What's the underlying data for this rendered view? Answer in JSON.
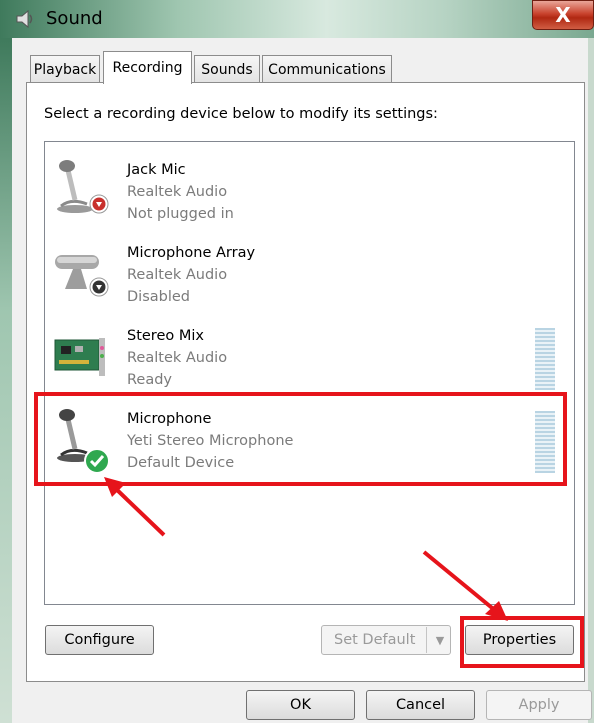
{
  "window": {
    "title": "Sound",
    "close_label": "X"
  },
  "tabs": [
    {
      "label": "Playback",
      "active": false
    },
    {
      "label": "Recording",
      "active": true
    },
    {
      "label": "Sounds",
      "active": false
    },
    {
      "label": "Communications",
      "active": false
    }
  ],
  "instruction": "Select a recording device below to modify its settings:",
  "devices": [
    {
      "name": "Jack Mic",
      "driver": "Realtek Audio",
      "status": "Not plugged in",
      "icon": "microphone-icon",
      "badge": "red-down-arrow"
    },
    {
      "name": "Microphone Array",
      "driver": "Realtek Audio",
      "status": "Disabled",
      "icon": "microphone-array-icon",
      "badge": "black-down-arrow"
    },
    {
      "name": "Stereo Mix",
      "driver": "Realtek Audio",
      "status": "Ready",
      "icon": "sound-card-icon",
      "badge": "",
      "level": 0
    },
    {
      "name": "Microphone",
      "driver": "Yeti Stereo Microphone",
      "status": "Default Device",
      "icon": "microphone-icon",
      "badge": "green-check",
      "level": 0
    }
  ],
  "buttons": {
    "configure": "Configure",
    "set_default": "Set Default",
    "properties": "Properties",
    "ok": "OK",
    "cancel": "Cancel",
    "apply": "Apply"
  },
  "colors": {
    "highlight": "#e6141b",
    "meter": "#b9d4e3",
    "check": "#2fa84f"
  }
}
